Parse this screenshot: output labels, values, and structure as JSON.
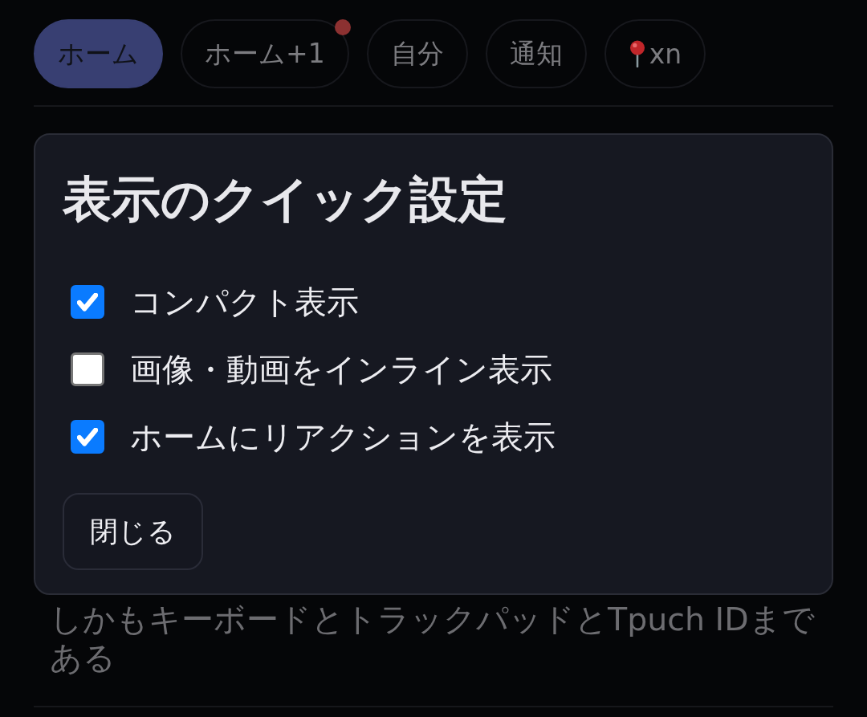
{
  "tabs": [
    {
      "kind": "text",
      "label": "ホーム",
      "selected": true,
      "unread": false
    },
    {
      "kind": "text",
      "label": "ホーム+1",
      "selected": false,
      "unread": true
    },
    {
      "kind": "text",
      "label": "自分",
      "selected": false,
      "unread": false
    },
    {
      "kind": "text",
      "label": "通知",
      "selected": false,
      "unread": false
    },
    {
      "kind": "pin",
      "label": "xn",
      "selected": false,
      "unread": false
    }
  ],
  "dialog": {
    "title": "表示のクイック設定",
    "options": [
      {
        "label": "コンパクト表示",
        "checked": true
      },
      {
        "label": "画像・動画をインライン表示",
        "checked": false
      },
      {
        "label": "ホームにリアクションを表示",
        "checked": true
      }
    ],
    "close_button": "閉じる"
  },
  "post": {
    "text": "しかもキーボードとトラックパッドとTpuch IDまである"
  }
}
